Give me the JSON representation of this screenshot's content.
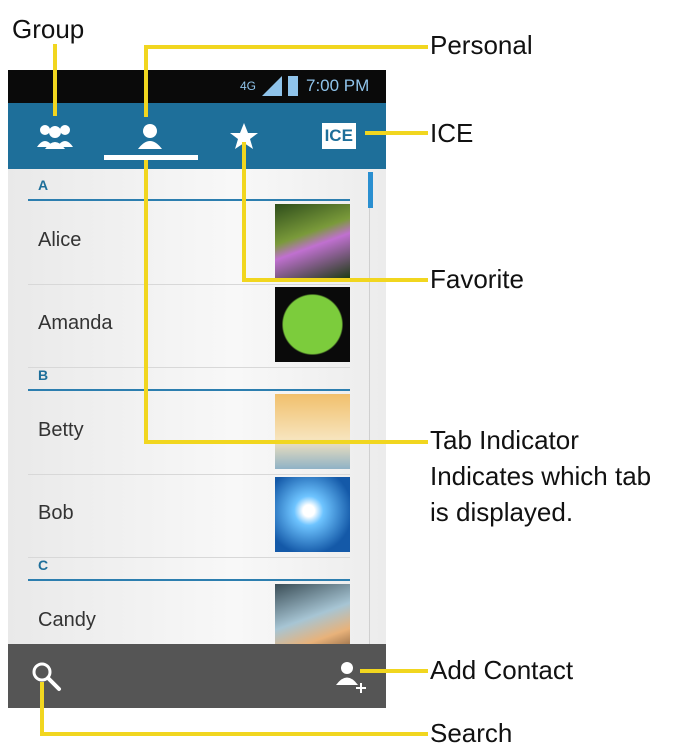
{
  "callouts": {
    "group": "Group",
    "personal": "Personal",
    "ice": "ICE",
    "favorite": "Favorite",
    "tab_indicator_l1": "Tab Indicator",
    "tab_indicator_l2": "Indicates which tab",
    "tab_indicator_l3": "is displayed.",
    "add_contact": "Add Contact",
    "search": "Search"
  },
  "status": {
    "network": "4G",
    "time": "7:00 PM"
  },
  "tabs": [
    {
      "icon": "group-icon"
    },
    {
      "icon": "person-icon",
      "selected": true
    },
    {
      "icon": "star-icon"
    },
    {
      "icon": "ice-icon",
      "text": "ICE"
    }
  ],
  "contacts": {
    "sections": [
      {
        "letter": "A",
        "items": [
          "Alice",
          "Amanda"
        ]
      },
      {
        "letter": "B",
        "items": [
          "Betty",
          "Bob"
        ]
      },
      {
        "letter": "C",
        "items": [
          "Candy"
        ]
      }
    ]
  },
  "bottom_bar": {
    "left_icon": "search-icon",
    "right_icon": "add-contact-icon"
  },
  "colors": {
    "callout_line": "#f1d61f",
    "tab_bar": "#1e6f9a",
    "accent": "#2c7eaf"
  }
}
